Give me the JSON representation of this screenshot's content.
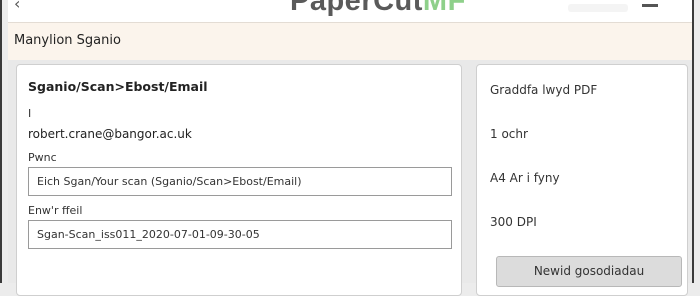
{
  "branding": {
    "logo_main": "PaperCut",
    "logo_suffix": "MF"
  },
  "title_bar": {
    "title": "Manylion Sganio"
  },
  "destination": {
    "title": "Sganio/Scan>Ebost/Email",
    "to_label": "I",
    "to_value": "robert.crane@bangor.ac.uk",
    "subject_label": "Pwnc",
    "subject_value": "Eich Sgan/Your scan (Sganio/Scan>Ebost/Email)",
    "filename_label": "Enw'r ffeil",
    "filename_value": "Sgan-Scan_iss011_2020-07-01-09-30-05"
  },
  "settings": {
    "color_mode": "Graddfa lwyd PDF",
    "sides": "1 ochr",
    "paper": "A4 Ar i fyny",
    "resolution": "300 DPI",
    "change_button": "Newid gosodiadau"
  },
  "icons": {
    "back": "back-arrow-icon",
    "menu": "menu-icon"
  },
  "colors": {
    "title_bar_bg": "#fbf4ec",
    "logo_accent": "#8ed08a",
    "button_bg": "#dcdcdc"
  }
}
